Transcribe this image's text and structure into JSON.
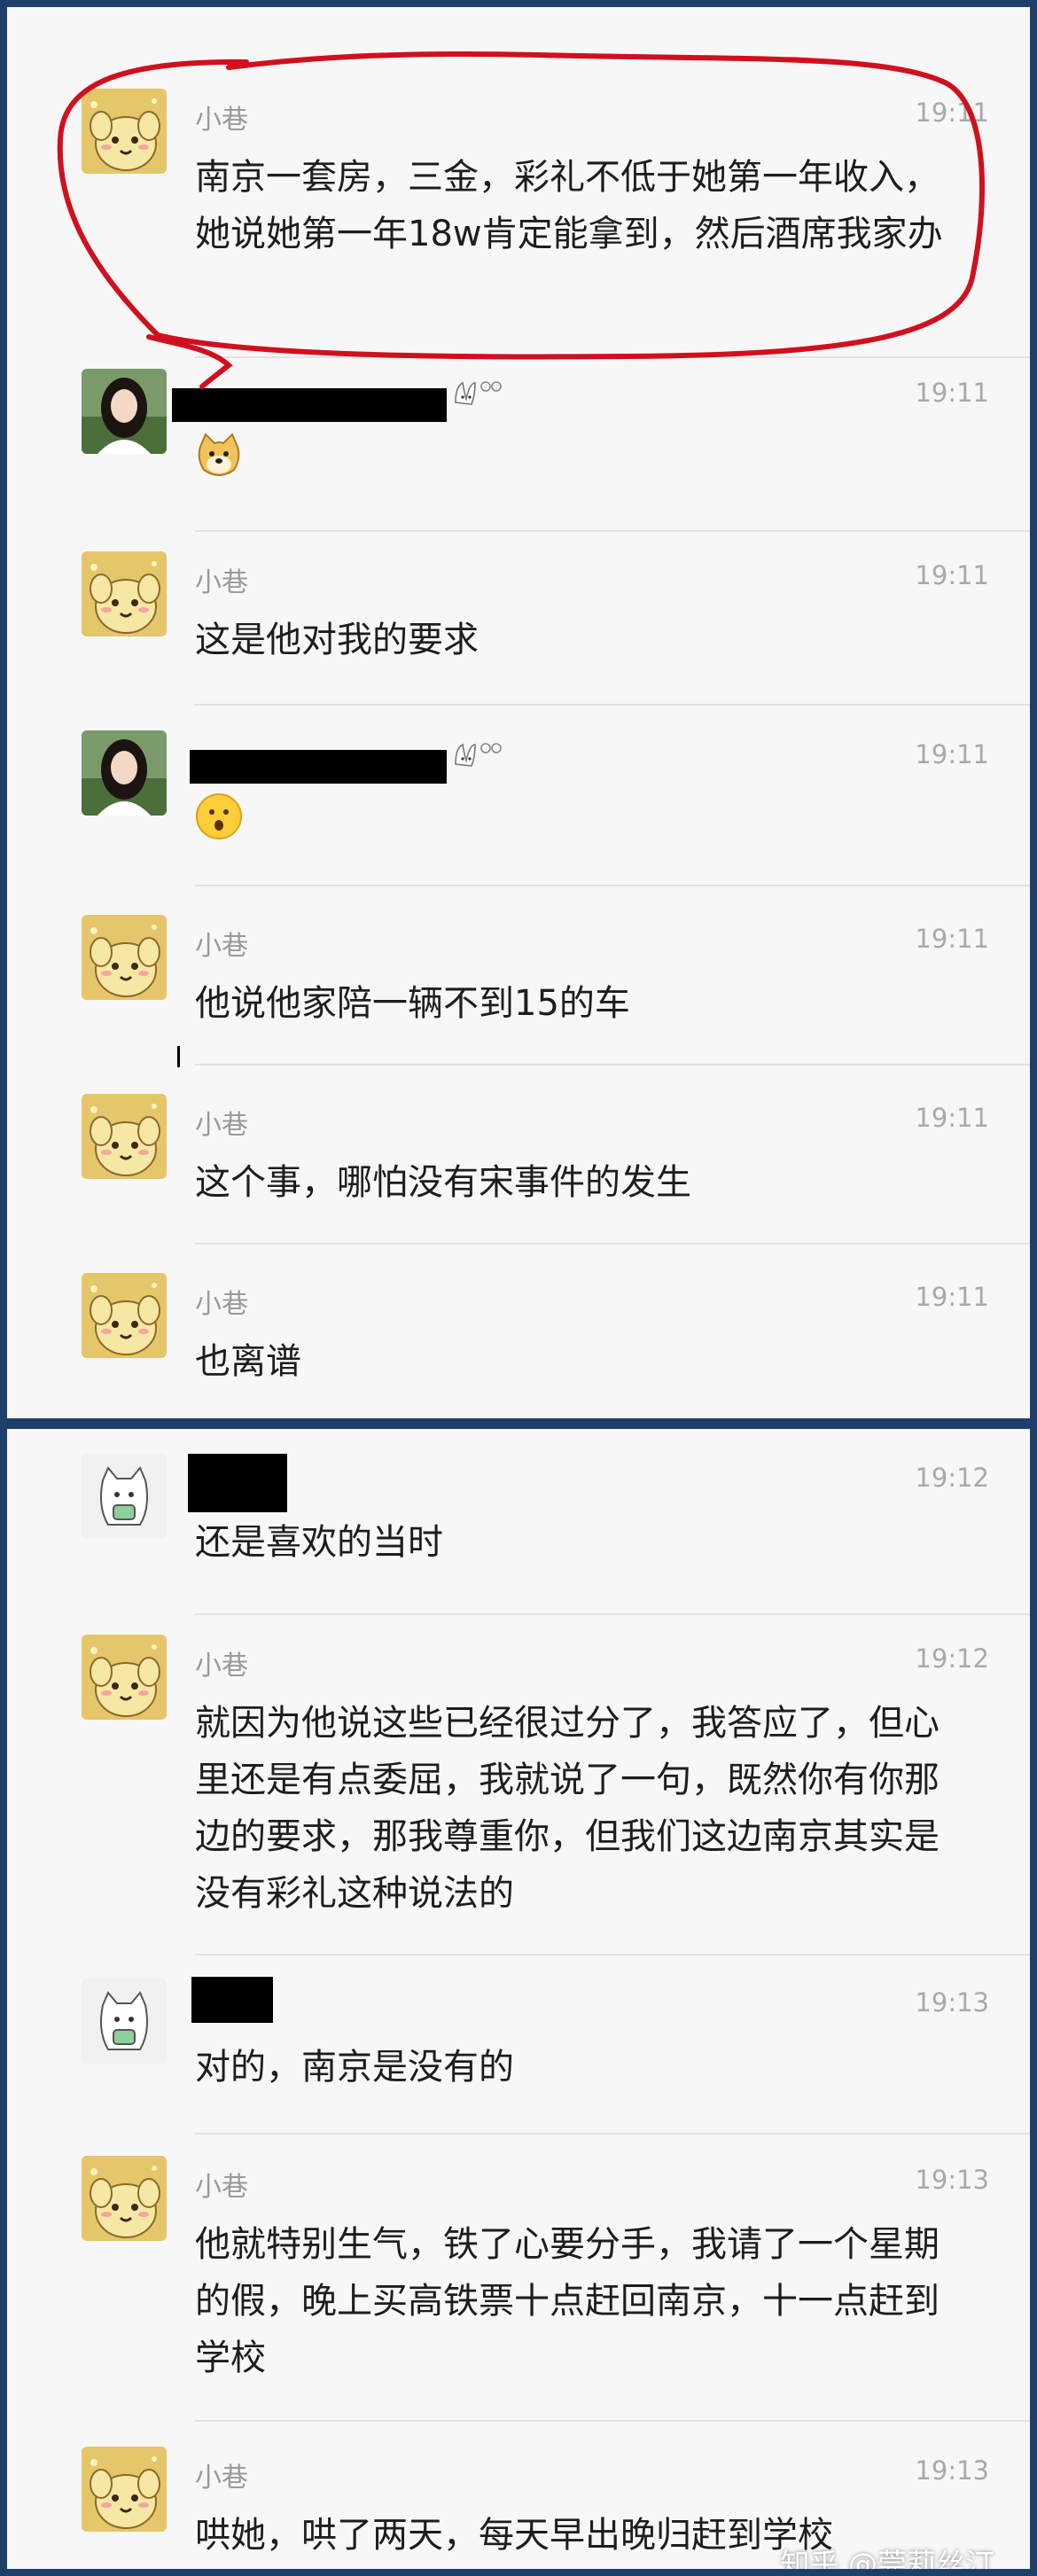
{
  "screenshot1": {
    "messages": [
      {
        "sender": "小巷",
        "time": "19:11",
        "text": "南京一套房，三金，彩礼不低于她第一年收入，她说她第一年18w肯定能拿到，然后酒席我家办"
      },
      {
        "sender": "",
        "time": "19:11",
        "emoji": "dog-face-emoji"
      },
      {
        "sender": "小巷",
        "time": "19:11",
        "text": "这是他对我的要求"
      },
      {
        "sender": "",
        "time": "19:11",
        "emoji": "surprised-face-emoji"
      },
      {
        "sender": "小巷",
        "time": "19:11",
        "text": "他说他家陪一辆不到15的车"
      },
      {
        "sender": "小巷",
        "time": "19:11",
        "text": "这个事，哪怕没有宋事件的发生"
      },
      {
        "sender": "小巷",
        "time": "19:11",
        "text": "也离谱"
      }
    ]
  },
  "screenshot2": {
    "messages": [
      {
        "sender": "",
        "time": "19:12",
        "text": "还是喜欢的当时"
      },
      {
        "sender": "小巷",
        "time": "19:12",
        "text": "就因为他说这些已经很过分了，我答应了，但心里还是有点委屈，我就说了一句，既然你有你那边的要求，那我尊重你，但我们这边南京其实是没有彩礼这种说法的"
      },
      {
        "sender": "",
        "time": "19:13",
        "text": "对的，南京是没有的"
      },
      {
        "sender": "小巷",
        "time": "19:13",
        "text": "他就特别生气，铁了心要分手，我请了一个星期的假，晚上买高铁票十点赶回南京，十一点赶到学校"
      },
      {
        "sender": "小巷",
        "time": "19:13",
        "text": "哄她，哄了两天，每天早出晚归赶到学校"
      }
    ],
    "watermark": "知乎 @莞莉丝汀"
  },
  "colors": {
    "background": "#1f3f6b",
    "panel": "#f7f7f7",
    "annotation": "#d0101f"
  }
}
